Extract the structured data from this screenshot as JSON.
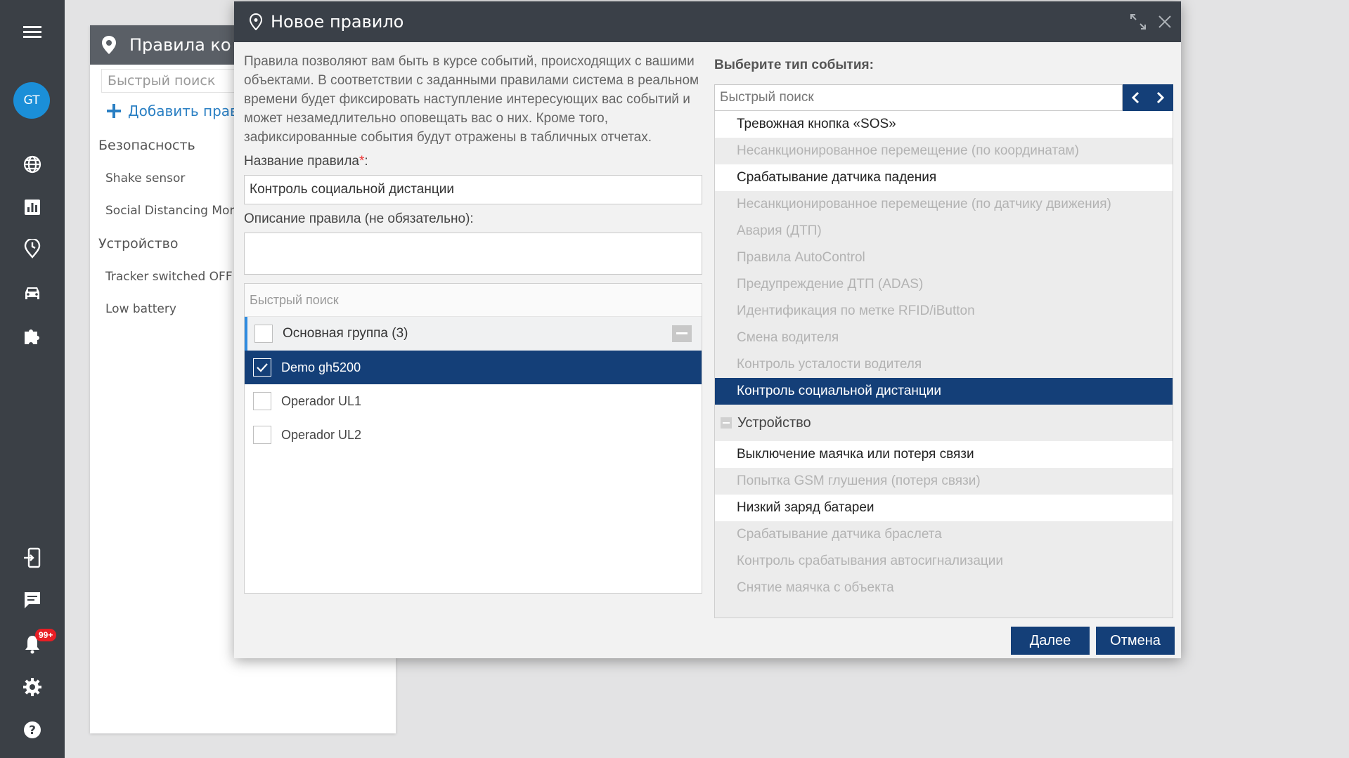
{
  "rail": {
    "avatar_initials": "GT",
    "notification_badge": "99+",
    "icons": [
      "menu-icon",
      "globe-icon",
      "chart-icon",
      "history-icon",
      "car-icon",
      "puzzle-icon",
      "login-icon",
      "chat-icon",
      "bell-icon",
      "gear-icon",
      "help-icon"
    ]
  },
  "bg_panel": {
    "title": "Правила ко",
    "search_placeholder": "Быстрый поиск",
    "add_label": "Добавить прав",
    "groups": [
      {
        "title": "Безопасность",
        "items": [
          "Shake sensor",
          "Social Distancing Mon"
        ]
      },
      {
        "title": "Устройство",
        "items": [
          "Tracker switched OFF",
          "Low battery"
        ]
      }
    ]
  },
  "dialog": {
    "title": "Новое правило",
    "description": "Правила позволяют вам быть в курсе событий, происходящих с вашими объектами. В соответствии с заданными правилами система в реальном времени будет фиксировать наступление интересующих вас событий и может незамедлительно оповещать вас о них. Кроме того, зафиксированные события будут отражены в табличных отчетах.",
    "name_label": "Название правила",
    "name_required_mark": "*",
    "name_label_suffix": ":",
    "name_value": "Контроль социальной дистанции",
    "desc_label": "Описание правила (не обязательно):",
    "desc_value": "",
    "objects": {
      "search_placeholder": "Быстрый поиск",
      "group_label": "Основная группа (3)",
      "items": [
        {
          "label": "Demo gh5200",
          "checked": true
        },
        {
          "label": "Operador UL1",
          "checked": false
        },
        {
          "label": "Operador UL2",
          "checked": false
        }
      ]
    },
    "event_type_label": "Выберите тип события:",
    "event_search_placeholder": "Быстрый поиск",
    "events": [
      {
        "label": "Тревожная кнопка «SOS»",
        "state": "enabled"
      },
      {
        "label": "Несанкционированное перемещение (по координатам)",
        "state": "disabled"
      },
      {
        "label": "Срабатывание датчика падения",
        "state": "enabled"
      },
      {
        "label": "Несанкционированное перемещение (по датчику движения)",
        "state": "disabled"
      },
      {
        "label": "Авария (ДТП)",
        "state": "disabled"
      },
      {
        "label": "Правила AutoControl",
        "state": "disabled"
      },
      {
        "label": "Предупреждение ДТП (ADAS)",
        "state": "disabled"
      },
      {
        "label": "Идентификация по метке RFID/iButton",
        "state": "disabled"
      },
      {
        "label": "Смена водителя",
        "state": "disabled"
      },
      {
        "label": "Контроль усталости водителя",
        "state": "disabled"
      },
      {
        "label": "Контроль социальной дистанции",
        "state": "selected"
      },
      {
        "label": "Устройство",
        "state": "category"
      },
      {
        "label": "Выключение маячка или потеря связи",
        "state": "enabled"
      },
      {
        "label": "Попытка GSM глушения (потеря связи)",
        "state": "disabled"
      },
      {
        "label": "Низкий заряд батареи",
        "state": "enabled"
      },
      {
        "label": "Срабатывание датчика браслета",
        "state": "disabled"
      },
      {
        "label": "Контроль срабатывания автосигнализации",
        "state": "disabled"
      },
      {
        "label": "Снятие маячка с объекта",
        "state": "disabled"
      }
    ],
    "next_label": "Далее",
    "cancel_label": "Отмена"
  },
  "colors": {
    "rail_bg": "#3b4046",
    "dialog_header": "#3a4048",
    "primary": "#143f78",
    "accent_blue": "#1b8fd8",
    "badge_red": "#e81e25"
  }
}
